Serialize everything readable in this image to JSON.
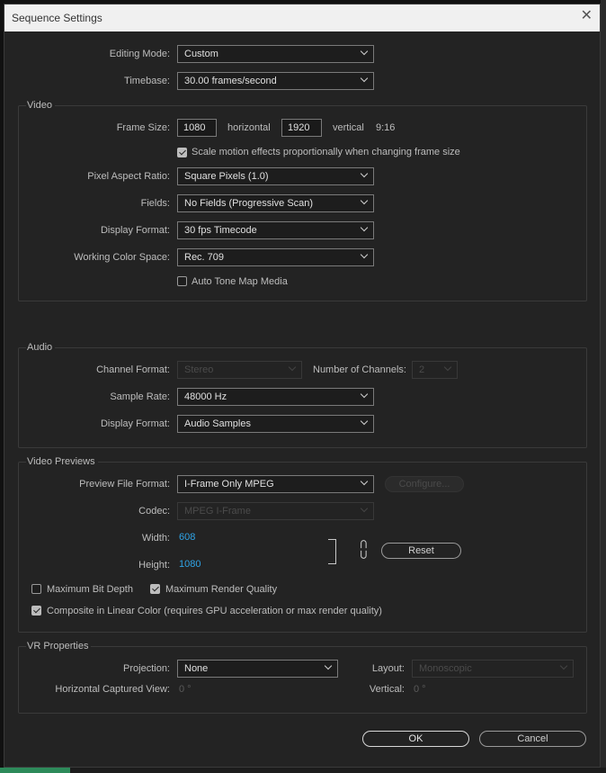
{
  "dialog": {
    "title": "Sequence Settings"
  },
  "general": {
    "editing_mode_label": "Editing Mode:",
    "editing_mode": "Custom",
    "timebase_label": "Timebase:",
    "timebase": "30.00  frames/second"
  },
  "video": {
    "group_title": "Video",
    "frame_size_label": "Frame Size:",
    "width": "1080",
    "horizontal_label": "horizontal",
    "height": "1920",
    "vertical_label": "vertical",
    "aspect": "9:16",
    "scale_motion_label": "Scale motion effects proportionally when changing frame size",
    "scale_motion_checked": true,
    "pixel_aspect_label": "Pixel Aspect Ratio:",
    "pixel_aspect": "Square Pixels (1.0)",
    "fields_label": "Fields:",
    "fields": "No Fields (Progressive Scan)",
    "display_format_label": "Display Format:",
    "display_format": "30 fps Timecode",
    "working_color_label": "Working Color Space:",
    "working_color": "Rec. 709",
    "auto_tone_label": "Auto Tone Map Media",
    "auto_tone_checked": false
  },
  "audio": {
    "group_title": "Audio",
    "channel_format_label": "Channel Format:",
    "channel_format": "Stereo",
    "num_channels_label": "Number of Channels:",
    "num_channels": "2",
    "sample_rate_label": "Sample Rate:",
    "sample_rate": "48000 Hz",
    "display_format_label": "Display Format:",
    "display_format": "Audio Samples"
  },
  "previews": {
    "group_title": "Video Previews",
    "preview_format_label": "Preview File Format:",
    "preview_format": "I-Frame Only MPEG",
    "configure_label": "Configure...",
    "codec_label": "Codec:",
    "codec": "MPEG I-Frame",
    "width_label": "Width:",
    "width": "608",
    "height_label": "Height:",
    "height": "1080",
    "reset_label": "Reset",
    "max_bit_depth_label": "Maximum Bit Depth",
    "max_bit_depth_checked": false,
    "max_render_label": "Maximum Render Quality",
    "max_render_checked": true,
    "composite_label": "Composite in Linear Color (requires GPU acceleration or max render quality)",
    "composite_checked": true
  },
  "vr": {
    "group_title": "VR Properties",
    "projection_label": "Projection:",
    "projection": "None",
    "layout_label": "Layout:",
    "layout": "Monoscopic",
    "hcv_label": "Horizontal Captured View:",
    "hcv": "0 °",
    "vertical_label": "Vertical:",
    "vertical": "0 °"
  },
  "footer": {
    "ok_label": "OK",
    "cancel_label": "Cancel"
  }
}
